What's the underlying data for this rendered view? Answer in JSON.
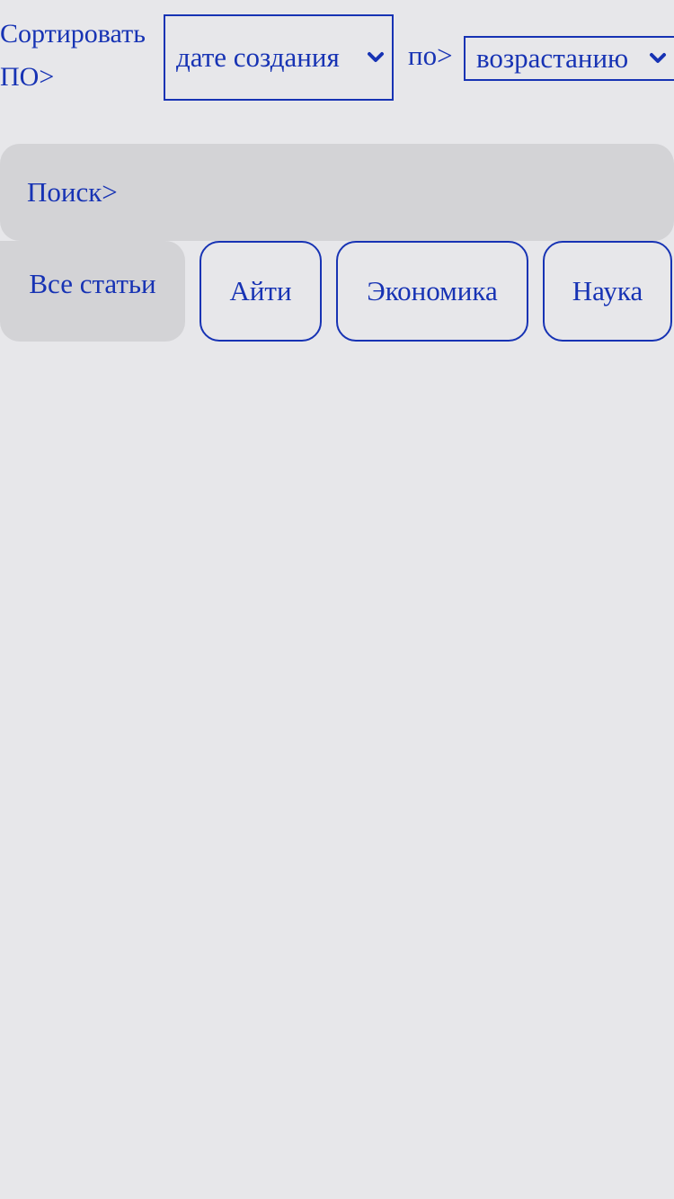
{
  "sort": {
    "label": "Сортировать ПО>",
    "field_value": "дате создания",
    "order_label": "по>",
    "order_value": "возрастанию"
  },
  "search": {
    "label": "Поиск>"
  },
  "filters": {
    "items": [
      {
        "label": "Все статьи",
        "active": true
      },
      {
        "label": "Айти",
        "active": false
      },
      {
        "label": "Экономика",
        "active": false
      },
      {
        "label": "Наука",
        "active": false
      }
    ]
  },
  "colors": {
    "accent": "#1733b4",
    "background": "#e7e7ea",
    "surface": "#d3d3d6"
  },
  "icons": {
    "dropdown": "chevron-down-icon"
  }
}
